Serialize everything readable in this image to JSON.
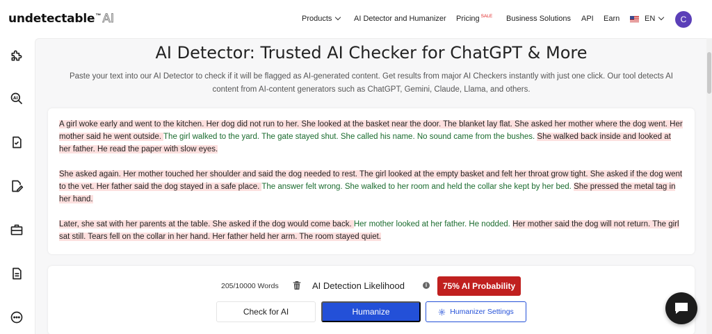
{
  "logo": {
    "main": "undetectable",
    "tm": "™",
    "ai": "AI"
  },
  "nav": {
    "products": "Products",
    "detector": "AI Detector and Humanizer",
    "pricing": "Pricing",
    "sale": "SALE",
    "business": "Business Solutions",
    "api": "API",
    "earn": "Earn",
    "language": "EN",
    "avatar_initial": "C"
  },
  "sidebar": {
    "icons": [
      "puzzle-icon",
      "search-ai-icon",
      "document-check-icon",
      "document-edit-icon",
      "briefcase-icon",
      "document-lines-icon",
      "more-icon"
    ]
  },
  "page": {
    "title": "AI Detector: Trusted AI Checker for ChatGPT & More",
    "subtitle": "Paste your text into our AI Detector to check if it will be flagged as AI-generated content. Get results from major AI Checkers instantly with just one click. Our tool detects AI content from AI-content generators such as ChatGPT, Gemini, Claude, Llama, and others."
  },
  "text": {
    "paragraphs": [
      [
        {
          "t": "A girl woke early and went to the kitchen. Her dog did not run to her. She looked at the basket near the door. The blanket lay flat. She asked her mother where the dog went. Her mother said he went outside. ",
          "ai": true
        },
        {
          "t": "The girl walked to the yard. The gate stayed shut. She called his name. No sound came from the bushes. ",
          "ai": false
        },
        {
          "t": "She walked back inside and looked at her father. He read the paper with slow eyes.",
          "ai": true
        }
      ],
      [
        {
          "t": "She asked again. Her mother touched her shoulder and said the dog needed to rest. The girl looked at the empty basket and felt her throat grow tight. She asked if the dog went to the vet. Her father said the dog stayed in a safe place. ",
          "ai": true
        },
        {
          "t": "The answer felt wrong. She walked to her room and held the collar she kept by her bed. ",
          "ai": false
        },
        {
          "t": "She pressed the metal tag in her hand.",
          "ai": true
        }
      ],
      [
        {
          "t": "Later, she sat with her parents at the table. She asked if the dog would come back. ",
          "ai": true
        },
        {
          "t": "Her mother looked at her father. He nodded. ",
          "ai": false
        },
        {
          "t": "Her mother said the dog will not return. The girl sat still. Tears fell on the collar in her hand. Her father held her arm. The room stayed quiet.",
          "ai": true
        }
      ]
    ]
  },
  "actions": {
    "word_count": "205/10000 Words",
    "detection_label": "AI Detection Likelihood",
    "info": "i",
    "probability": "75% AI Probability",
    "check_button": "Check for AI",
    "humanize_button": "Humanize",
    "settings_button": "Humanizer Settings"
  },
  "colors": {
    "accent": "#2350d8",
    "danger": "#c0201f",
    "ai_highlight": "#fde0df",
    "human_text": "#1a6b2e",
    "avatar": "#5b3fb8"
  }
}
